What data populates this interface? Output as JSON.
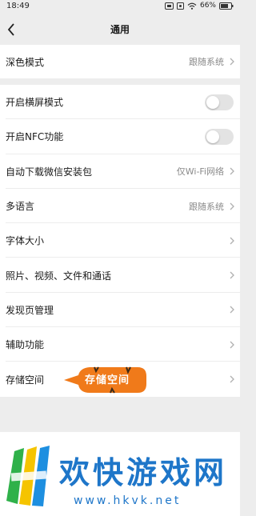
{
  "status_bar": {
    "time": "18:49",
    "battery": "66%"
  },
  "nav": {
    "title": "通用"
  },
  "group1": [
    {
      "label": "深色模式",
      "value": "跟随系统"
    }
  ],
  "settings": {
    "landscape": {
      "label": "开启横屏模式",
      "enabled": false
    },
    "nfc": {
      "label": "开启NFC功能",
      "enabled": false
    },
    "auto_download": {
      "label": "自动下载微信安装包",
      "value": "仅Wi-Fi网络"
    },
    "language": {
      "label": "多语言",
      "value": "跟随系统"
    },
    "font_size": {
      "label": "字体大小"
    },
    "media": {
      "label": "照片、视频、文件和通话"
    },
    "discover": {
      "label": "发现页管理"
    },
    "accessibility": {
      "label": "辅助功能"
    },
    "storage": {
      "label": "存储空间"
    }
  },
  "callout": {
    "text": "存储空间",
    "color": "#f07a1a"
  },
  "watermark": {
    "title": "欢快游戏网",
    "url": "www.hkvk.net",
    "color": "#1e76c9"
  }
}
